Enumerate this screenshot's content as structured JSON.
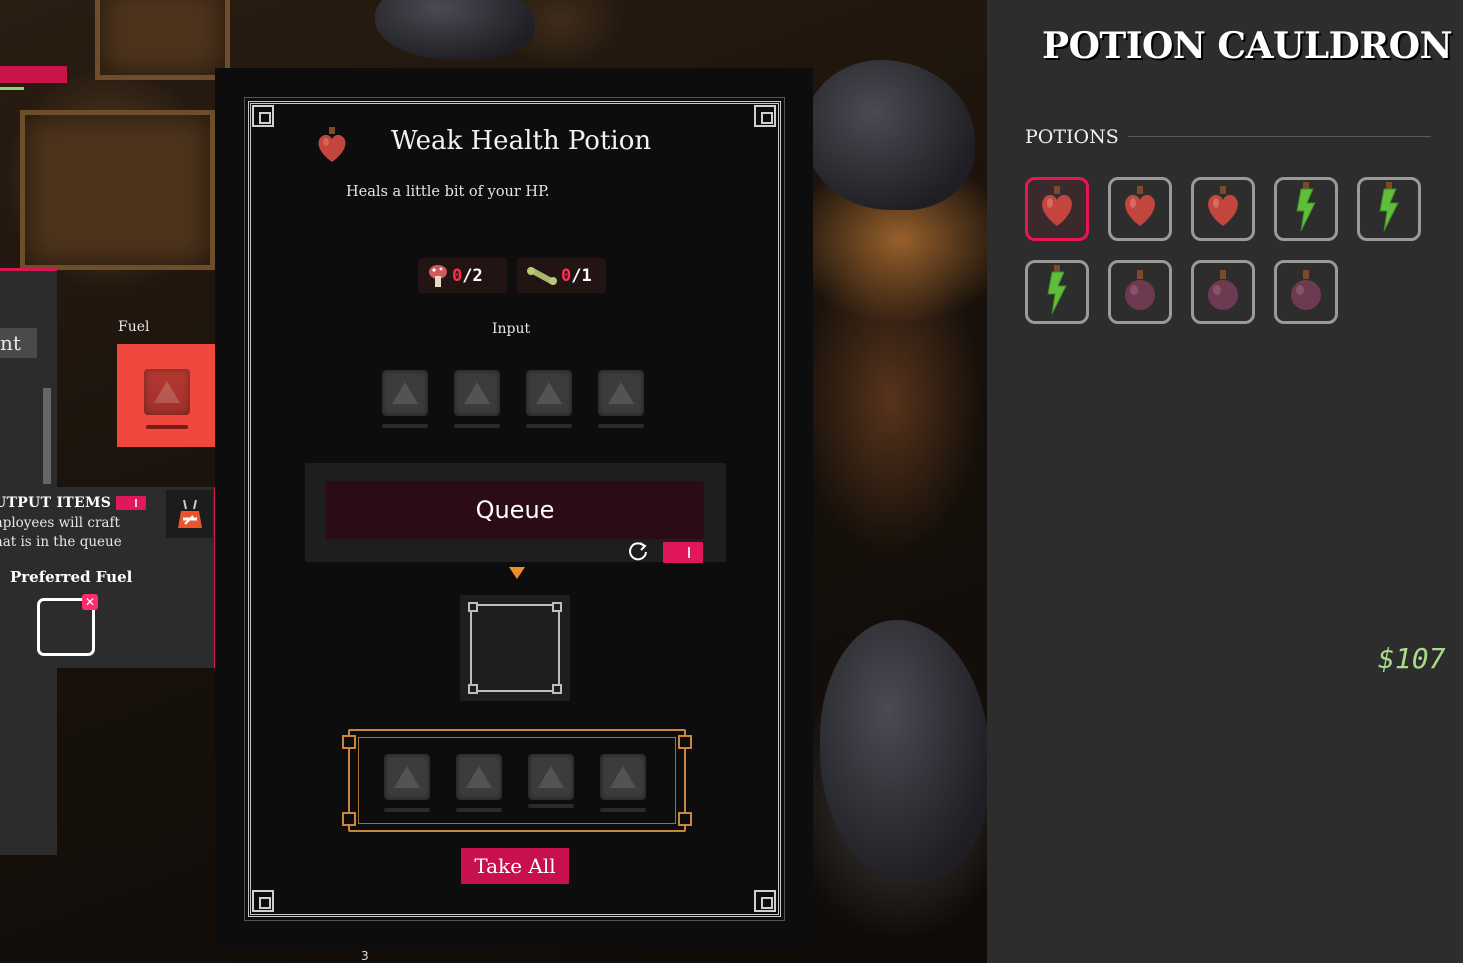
{
  "left_panel": {
    "tab_label": "nt",
    "fuel_label": "Fuel",
    "output_items_title": "UTPUT ITEMS",
    "output_items_desc_line1": "nployees will craft",
    "output_items_desc_line2": "hat is in the queue",
    "preferred_fuel_label": "Preferred Fuel"
  },
  "recipe": {
    "name": "Weak Health Potion",
    "description": "Heals a little bit of your HP.",
    "ingredients": [
      {
        "icon": "mushroom-icon",
        "have": "0",
        "need_sep": "/2"
      },
      {
        "icon": "bone-icon",
        "have": "0",
        "need_sep": "/1"
      }
    ],
    "input_label": "Input",
    "queue_label": "Queue",
    "take_all_label": "Take All",
    "page_number": "3"
  },
  "cauldron": {
    "title": "POTION CAULDRON",
    "section_label": "POTIONS",
    "potions": [
      {
        "icon": "red-heart-potion-icon",
        "selected": true
      },
      {
        "icon": "red-heart-potion-icon",
        "selected": false
      },
      {
        "icon": "red-heart-potion-icon",
        "selected": false
      },
      {
        "icon": "green-bolt-potion-icon",
        "selected": false
      },
      {
        "icon": "green-bolt-potion-icon",
        "selected": false
      },
      {
        "icon": "green-bolt-potion-icon",
        "selected": false
      },
      {
        "icon": "purple-round-potion-icon",
        "selected": false
      },
      {
        "icon": "purple-round-potion-icon",
        "selected": false
      },
      {
        "icon": "purple-round-potion-icon",
        "selected": false
      }
    ]
  },
  "money": "$107",
  "colors": {
    "accent": "#e0185a",
    "fuel_slot": "#f0483e",
    "ingredient_missing": "#ff2d55",
    "output_frame": "#c8873a",
    "money": "#a8dc8a"
  }
}
